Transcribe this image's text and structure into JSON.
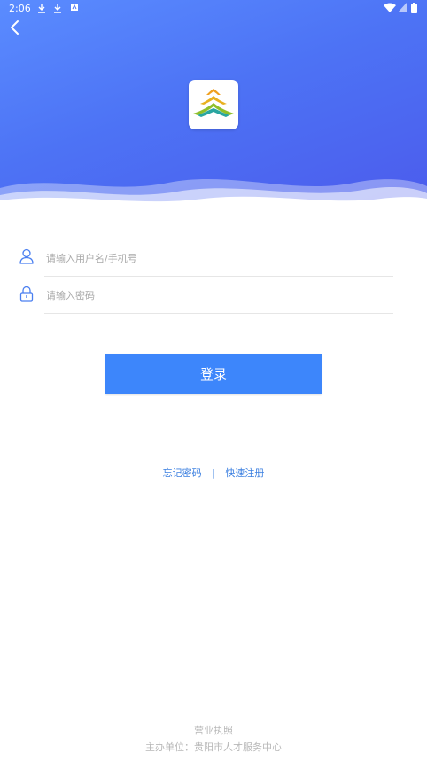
{
  "status_bar": {
    "time": "2:06",
    "icons": [
      "download-icon",
      "download-icon",
      "android-icon",
      "wifi-icon",
      "signal-icon",
      "battery-icon"
    ]
  },
  "header": {
    "back_icon": "chevron-left-icon",
    "logo_icon": "app-logo",
    "colors": {
      "gradient_start": "#5a8cff",
      "gradient_end": "#4b5bec"
    }
  },
  "form": {
    "username": {
      "icon": "user-icon",
      "value": "",
      "placeholder": "请输入用户名/手机号"
    },
    "password": {
      "icon": "lock-icon",
      "value": "",
      "placeholder": "请输入密码"
    },
    "login_label": "登录",
    "login_color": "#3d86fb"
  },
  "links": {
    "forgot_password": "忘记密码",
    "separator": "|",
    "quick_register": "快速注册"
  },
  "footer": {
    "business_license": "营业执照",
    "organizer": "主办单位：贵阳市人才服务中心"
  }
}
